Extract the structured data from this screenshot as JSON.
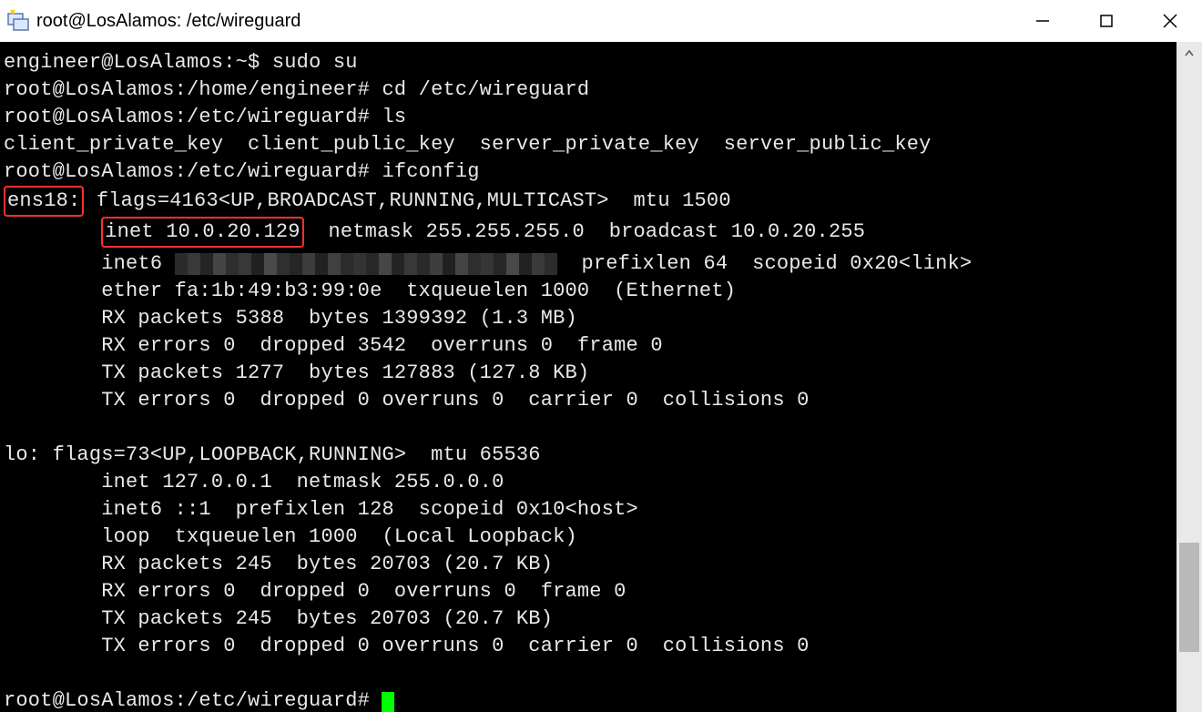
{
  "window": {
    "title": "root@LosAlamos: /etc/wireguard"
  },
  "term": {
    "line1_prompt": "engineer@LosAlamos:~$ ",
    "line1_cmd": "sudo su",
    "line2_prompt": "root@LosAlamos:/home/engineer# ",
    "line2_cmd": "cd /etc/wireguard",
    "line3_prompt": "root@LosAlamos:/etc/wireguard# ",
    "line3_cmd": "ls",
    "line4": "client_private_key  client_public_key  server_private_key  server_public_key",
    "line5_prompt": "root@LosAlamos:/etc/wireguard# ",
    "line5_cmd": "ifconfig",
    "ens18_label": "ens18:",
    "ens18_flags": " flags=4163<UP,BROADCAST,RUNNING,MULTICAST>  mtu 1500",
    "ens18_inet_boxed": "inet 10.0.20.129",
    "ens18_inet_rest": "  netmask 255.255.255.0  broadcast 10.0.20.255",
    "ens18_inet6_pre": "        inet6 ",
    "ens18_inet6_post": "  prefixlen 64  scopeid 0x20<link>",
    "ens18_ether": "        ether fa:1b:49:b3:99:0e  txqueuelen 1000  (Ethernet)",
    "ens18_rxp": "        RX packets 5388  bytes 1399392 (1.3 MB)",
    "ens18_rxe": "        RX errors 0  dropped 3542  overruns 0  frame 0",
    "ens18_txp": "        TX packets 1277  bytes 127883 (127.8 KB)",
    "ens18_txe": "        TX errors 0  dropped 0 overruns 0  carrier 0  collisions 0",
    "lo_header": "lo: flags=73<UP,LOOPBACK,RUNNING>  mtu 65536",
    "lo_inet": "        inet 127.0.0.1  netmask 255.0.0.0",
    "lo_inet6": "        inet6 ::1  prefixlen 128  scopeid 0x10<host>",
    "lo_loop": "        loop  txqueuelen 1000  (Local Loopback)",
    "lo_rxp": "        RX packets 245  bytes 20703 (20.7 KB)",
    "lo_rxe": "        RX errors 0  dropped 0  overruns 0  frame 0",
    "lo_txp": "        TX packets 245  bytes 20703 (20.7 KB)",
    "lo_txe": "        TX errors 0  dropped 0 overruns 0  carrier 0  collisions 0",
    "final_prompt": "root@LosAlamos:/etc/wireguard# "
  }
}
